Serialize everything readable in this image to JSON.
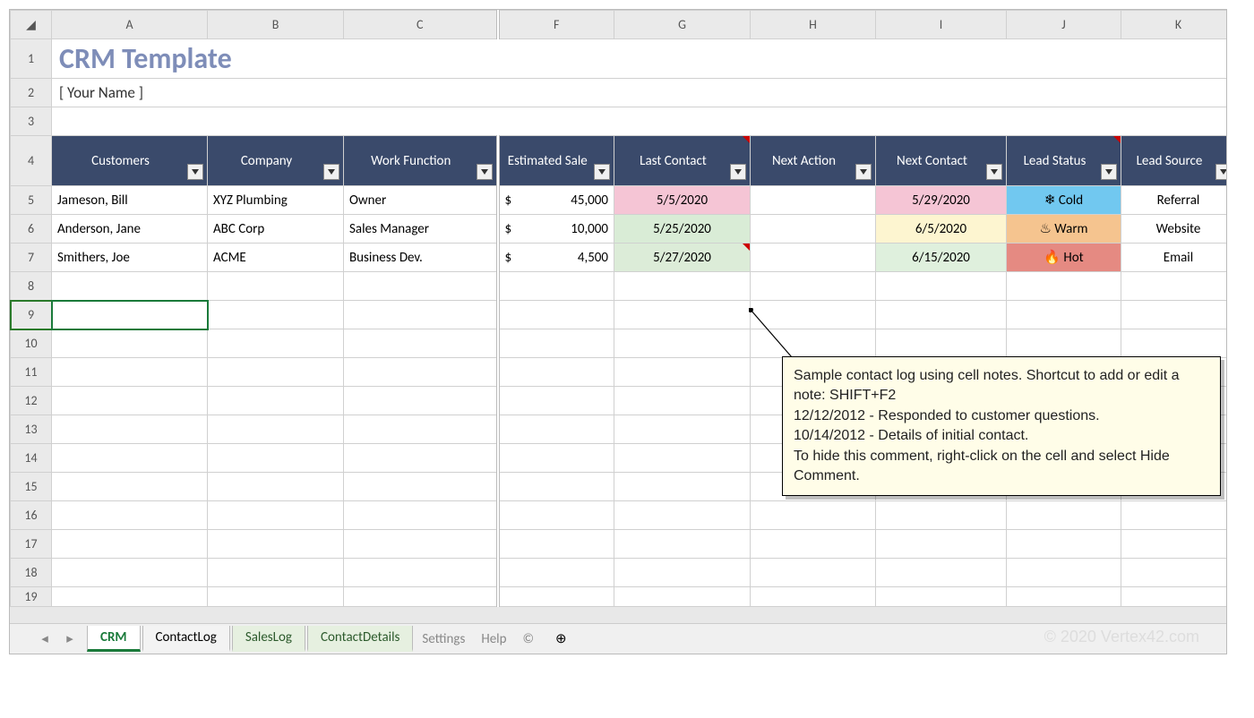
{
  "columns": [
    "A",
    "B",
    "C",
    "F",
    "G",
    "H",
    "I",
    "J",
    "K"
  ],
  "rowNums": [
    "1",
    "2",
    "3",
    "4",
    "5",
    "6",
    "7",
    "8",
    "9",
    "10",
    "11",
    "12",
    "13",
    "14",
    "15",
    "16",
    "17",
    "18",
    "19"
  ],
  "title": "CRM Template",
  "subtitle": "[ Your Name ]",
  "headers": {
    "customers": "Customers",
    "company": "Company",
    "work": "Work Function",
    "est": "Estimated Sale",
    "last": "Last Contact",
    "nextAction": "Next Action",
    "nextContact": "Next Contact",
    "status": "Lead Status",
    "source": "Lead Source"
  },
  "rows": [
    {
      "name": "Jameson, Bill",
      "company": "XYZ Plumbing",
      "work": "Owner",
      "est": "45,000",
      "last": "5/5/2020",
      "next": "5/29/2020",
      "status": "Cold",
      "source": "Referral",
      "lastBg": "bg-pink",
      "nextBg": "bg-pink",
      "statusBg": "bg-cold",
      "statusIcon": "❄"
    },
    {
      "name": "Anderson, Jane",
      "company": "ABC Corp",
      "work": "Sales Manager",
      "est": "10,000",
      "last": "5/25/2020",
      "next": "6/5/2020",
      "status": "Warm",
      "source": "Website",
      "lastBg": "bg-lg",
      "nextBg": "bg-ly",
      "statusBg": "bg-warm",
      "statusIcon": "♨"
    },
    {
      "name": "Smithers, Joe",
      "company": "ACME",
      "work": "Business Dev.",
      "est": "4,500",
      "last": "5/27/2020",
      "next": "6/15/2020",
      "status": "Hot",
      "source": "Email",
      "lastBg": "bg-lg2",
      "nextBg": "bg-lg3",
      "statusBg": "bg-hot",
      "statusIcon": "🔥"
    }
  ],
  "comment": {
    "l1": "Sample contact log using cell notes. Shortcut to add or edit a note: SHIFT+F2",
    "l2": "",
    "l3": "12/12/2012 - Responded to customer questions.",
    "l4": "",
    "l5": "10/14/2012 - Details of initial contact.",
    "l6": "",
    "l7": "To hide this comment, right-click on the cell and select Hide Comment."
  },
  "tabs": {
    "crm": "CRM",
    "contactLog": "ContactLog",
    "salesLog": "SalesLog",
    "contactDetails": "ContactDetails",
    "settings": "Settings",
    "help": "Help",
    "copyright": "©"
  },
  "watermark": "© 2020 Vertex42.com",
  "dollar": "$"
}
